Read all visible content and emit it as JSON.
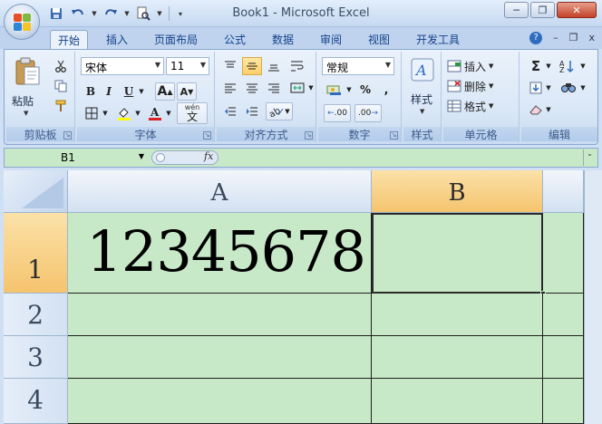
{
  "window": {
    "title": "Book1 - Microsoft Excel",
    "minimize_glyph": "─",
    "restore_glyph": "❐",
    "close_glyph": "✕"
  },
  "quick_access": {
    "icons": [
      "save-icon",
      "undo-icon",
      "redo-icon",
      "print-preview-icon",
      "customize-qat-icon"
    ]
  },
  "tabs": [
    {
      "label": "开始",
      "active": true
    },
    {
      "label": "插入"
    },
    {
      "label": "页面布局"
    },
    {
      "label": "公式"
    },
    {
      "label": "数据"
    },
    {
      "label": "审阅"
    },
    {
      "label": "视图"
    },
    {
      "label": "开发工具"
    }
  ],
  "tab_right": {
    "help_glyph": "?",
    "min_glyph": "–",
    "restore_glyph": "❐",
    "close_glyph": "x"
  },
  "ribbon": {
    "clipboard": {
      "label": "剪贴板",
      "paste_label": "粘贴"
    },
    "font": {
      "label": "字体",
      "family": "宋体",
      "size": "11",
      "bold": "B",
      "italic": "I",
      "underline": "U",
      "grow": "A",
      "shrink": "A",
      "phonetic": "wén",
      "phonetic_char": "文"
    },
    "alignment": {
      "label": "对齐方式"
    },
    "number": {
      "label": "数字",
      "format": "常规",
      "percent": "%",
      "comma": ",",
      "inc_decimal": ".00",
      "dec_decimal": ".00"
    },
    "styles": {
      "label": "样式"
    },
    "cells": {
      "label": "单元格",
      "insert": "插入",
      "delete": "删除",
      "format": "格式"
    },
    "editing": {
      "label": "编辑",
      "sum": "Σ"
    }
  },
  "formula_bar": {
    "name_box": "B1",
    "fx": "fx",
    "formula": ""
  },
  "grid": {
    "columns": [
      {
        "label": "A",
        "selected": false
      },
      {
        "label": "B",
        "selected": true
      }
    ],
    "rows": [
      {
        "label": "1",
        "selected": true
      },
      {
        "label": "2"
      },
      {
        "label": "3"
      },
      {
        "label": "4"
      }
    ],
    "cells": {
      "A1": "12345678",
      "B1": ""
    },
    "active_cell": "B1",
    "cell_background": "#c8e9c8"
  }
}
